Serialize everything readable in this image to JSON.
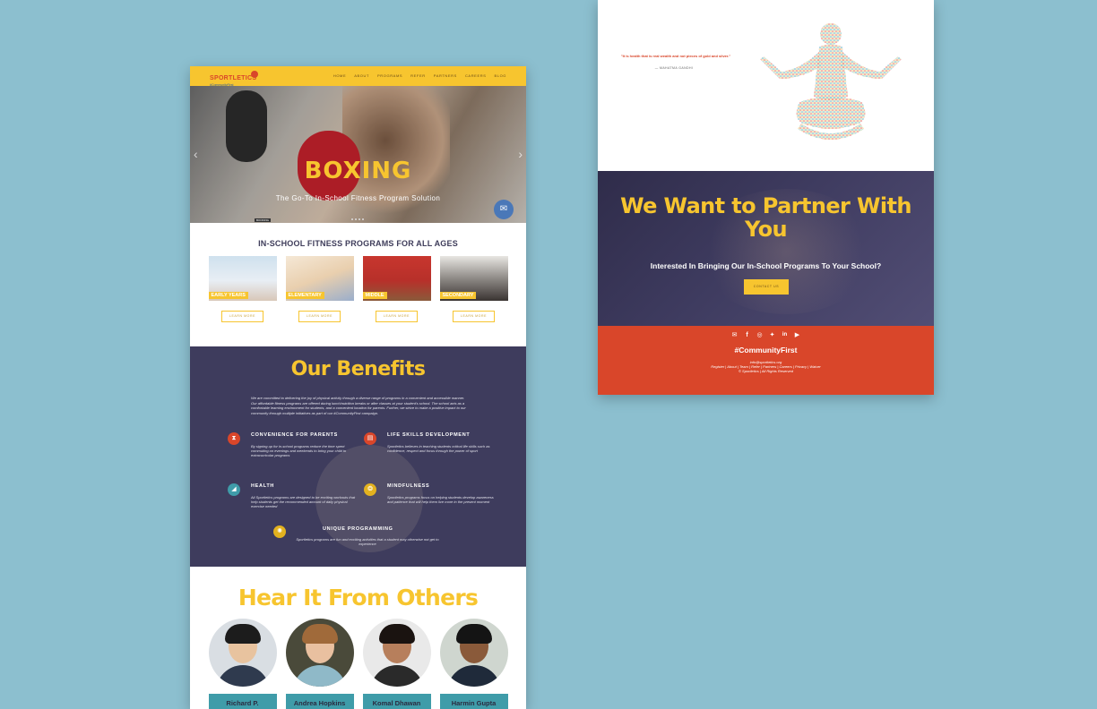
{
  "left_site": {
    "logo": {
      "name": "SPORTLETICS",
      "tagline": "#CommunityFirst"
    },
    "nav": [
      "HOME",
      "ABOUT",
      "PROGRAMS",
      "REFER",
      "PARTNERS",
      "CAREERS",
      "BLOG"
    ],
    "hero": {
      "title": "BOXING",
      "subtitle": "The Go-To In-School Fitness Program Solution",
      "tag": "BOOKING"
    },
    "programs": {
      "title": "IN-SCHOOL FITNESS PROGRAMS FOR ALL AGES",
      "items": [
        {
          "label": "EARLY YEARS",
          "button": "LEARN MORE"
        },
        {
          "label": "ELEMENTARY",
          "button": "LEARN MORE"
        },
        {
          "label": "MIDDLE",
          "button": "LEARN MORE"
        },
        {
          "label": "SECONDARY",
          "button": "LEARN MORE"
        }
      ]
    },
    "benefits": {
      "title": "Our Benefits",
      "intro": "We are committed to delivering the joy of physical activity through a diverse range of programs in a convenient and accessible manner. Our affordable fitness programs are offered during lunch/nutrition breaks or after classes at your student's school. The school acts as a comfortable learning environment for students, and a convenient location for parents. Further, we strive to make a positive impact to our community through multiple initiatives as part of our #CommunityFirst campaign.",
      "items": [
        {
          "title": "CONVENIENCE FOR PARENTS",
          "text": "By signing up for in-school programs reduce the time spent commuting on evenings and weekends to bring your child to extracurricular programs",
          "icon": "hourglass-icon",
          "color": "#d9462a"
        },
        {
          "title": "LIFE SKILLS DEVELOPMENT",
          "text": "Sportletics believes in teaching students critical life skills such as confidence, respect and focus through the power of sport",
          "icon": "book-icon",
          "color": "#d9462a"
        },
        {
          "title": "HEALTH",
          "text": "All Sportletics programs are designed to be exciting workouts that help students get the recommended amount of daily physical exercise needed",
          "icon": "sneaker-icon",
          "color": "#3f9ca9"
        },
        {
          "title": "MINDFULNESS",
          "text": "Sportletics programs focus on helping students develop awareness and patience that will help them live more in the present moment",
          "icon": "brain-icon",
          "color": "#e3b21f"
        },
        {
          "title": "UNIQUE PROGRAMMING",
          "text": "Sportletics programs are fun and exciting activities that a student may otherwise not get to experience",
          "icon": "lightbulb-icon",
          "color": "#e3b21f"
        }
      ]
    },
    "testimonials": {
      "title": "Hear It From Others",
      "people": [
        "Richard P.",
        "Andrea Hopkins",
        "Komal Dhawan",
        "Harmin Gupta"
      ]
    }
  },
  "right_site": {
    "quote": {
      "text": "\"It is health that is real wealth and not pieces of gold and silver.\"",
      "author": "— MAHATMA GANDHI"
    },
    "partner": {
      "title": "We Want to Partner With You",
      "subtitle": "Interested In Bringing Our In-School Programs To Your School?",
      "button": "CONTACT US"
    },
    "footer": {
      "social_icons": [
        "mail-icon",
        "facebook-icon",
        "instagram-icon",
        "twitter-icon",
        "linkedin-icon",
        "youtube-icon"
      ],
      "hashtag": "#CommunityFirst",
      "email": "info@sportletics.org",
      "links": "Register | About | Team | Refer | Partners | Careers | Privacy | Waiver",
      "copyright": "© Sportletics | All Rights Reserved"
    }
  },
  "colors": {
    "background": "#8cbfcf",
    "brand_yellow": "#f7c52f",
    "brand_navy": "#3e3c5d",
    "brand_red": "#d9462a",
    "brand_teal": "#3f9ca9"
  }
}
